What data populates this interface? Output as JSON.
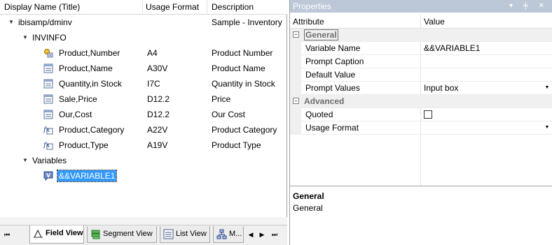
{
  "tree": {
    "columns": {
      "name": "Display Name (Title)",
      "format": "Usage Format",
      "description": "Description"
    },
    "root": {
      "label": "ibisamp/dminv",
      "description": "Sample - Inventory"
    },
    "segment": {
      "label": "INVINFO"
    },
    "fields": [
      {
        "name": "Product,Number",
        "format": "A4",
        "description": "Product Number",
        "icon": "key-field-icon"
      },
      {
        "name": "Product,Name",
        "format": "A30V",
        "description": "Product Name",
        "icon": "field-icon"
      },
      {
        "name": "Quantity,in Stock",
        "format": "I7C",
        "description": "Quantity in Stock",
        "icon": "field-icon"
      },
      {
        "name": "Sale,Price",
        "format": "D12.2",
        "description": "Price",
        "icon": "field-icon"
      },
      {
        "name": "Our,Cost",
        "format": "D12.2",
        "description": "Our Cost",
        "icon": "field-icon"
      },
      {
        "name": "Product,Category",
        "format": "A22V",
        "description": "Product Category",
        "icon": "computed-field-icon"
      },
      {
        "name": "Product,Type",
        "format": "A19V",
        "description": "Product Type",
        "icon": "computed-field-icon"
      }
    ],
    "variables": {
      "label": "Variables",
      "items": [
        {
          "name": "&&VARIABLE1",
          "icon": "variable-icon"
        }
      ]
    }
  },
  "tabs": [
    {
      "label": "Field View",
      "icon": "field-view-icon",
      "active": true
    },
    {
      "label": "Segment View",
      "icon": "segment-view-icon",
      "active": false
    },
    {
      "label": "List View",
      "icon": "list-view-icon",
      "active": false
    },
    {
      "label": "M...",
      "icon": "modeling-view-icon",
      "active": false
    }
  ],
  "nav": {
    "first": "⏮",
    "prev": "◀",
    "next": "▶",
    "last": "⏭"
  },
  "properties": {
    "title": "Properties",
    "title_buttons": "▾ ╪ ✕",
    "columns": {
      "attribute": "Attribute",
      "value": "Value"
    },
    "categories": [
      {
        "label": "General",
        "toggle": "−",
        "rows": [
          {
            "attribute": "Variable Name",
            "value": "&&VARIABLE1"
          },
          {
            "attribute": "Prompt Caption",
            "value": ""
          },
          {
            "attribute": "Default Value",
            "value": ""
          },
          {
            "attribute": "Prompt Values",
            "value": "Input box",
            "dropdown": true
          }
        ]
      },
      {
        "label": "Advanced",
        "toggle": "−",
        "rows": [
          {
            "attribute": "Quoted",
            "value": "",
            "checkbox": true,
            "checked": false
          },
          {
            "attribute": "Usage Format",
            "value": "",
            "dropdown": true
          }
        ]
      }
    ],
    "description": {
      "title": "General",
      "text": "General"
    }
  },
  "colors": {
    "selection": "#3399ff",
    "title_bar": "#bcc7d8",
    "category_bg": "#f0f0f0"
  }
}
